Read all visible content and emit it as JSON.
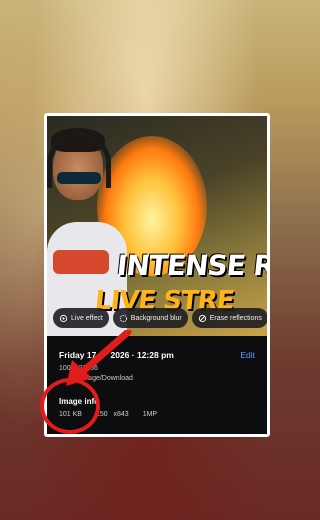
{
  "thumbnail": {
    "title_line1": "INTENSE R",
    "title_line2": "LIVE STRE"
  },
  "chips": [
    {
      "label": "Live effect",
      "icon": "live-effect-icon"
    },
    {
      "label": "Background blur",
      "icon": "background-blur-icon"
    },
    {
      "label": "Erase reflections",
      "icon": "erase-reflections-icon"
    }
  ],
  "details": {
    "date": "Friday 17",
    "date_suffix": "2026 · 12:28 pm",
    "edit_label": "Edit",
    "filename": "1000127186",
    "path_partial": "storage/Download",
    "image_info_title": "Image info",
    "size": "101 KB",
    "resolution": "150",
    "resolution_suffix": "x843",
    "megapixels": "1MP"
  },
  "colors": {
    "accent_edit": "#5aa0ff",
    "annotation_red": "#e01c1c",
    "title_yellow": "#ffb31a"
  }
}
